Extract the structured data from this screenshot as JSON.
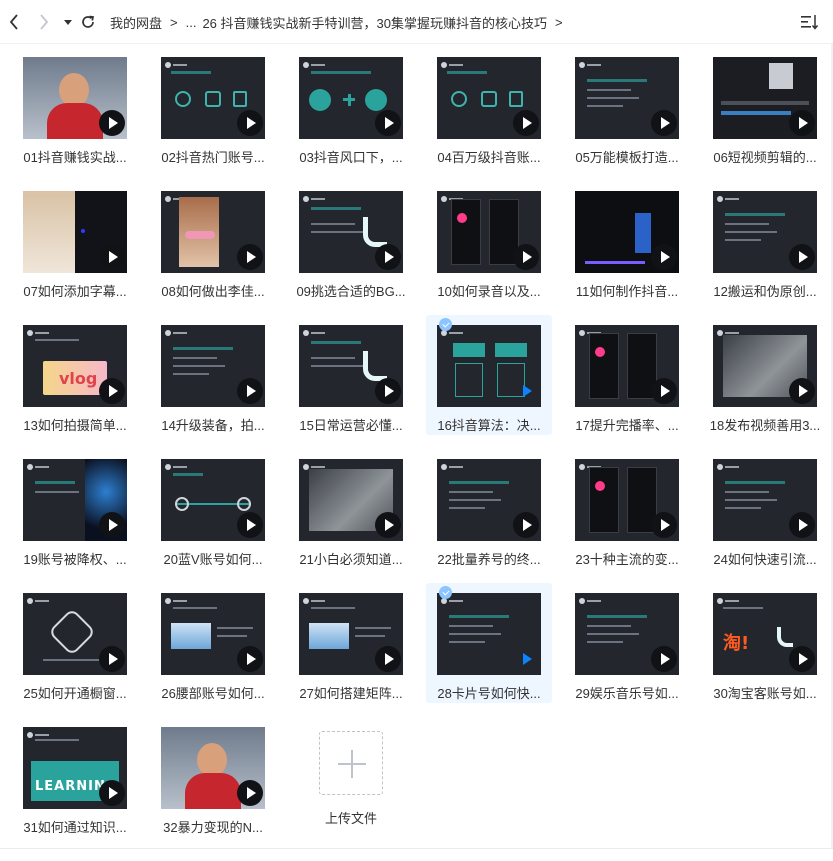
{
  "nav": {
    "back": "back-icon",
    "forward": "forward-icon",
    "history": "chevron-down-icon",
    "refresh": "refresh-icon"
  },
  "breadcrumb": {
    "root": "我的网盘",
    "sep1": ">",
    "ellipsis": "...",
    "current": "26 抖音赚钱实战新手特训营，30集掌握玩赚抖音的核心技巧",
    "sep2": ">",
    "sep3": ">"
  },
  "sort": {
    "icon": "sort-icon"
  },
  "files": [
    {
      "name": "01抖音赚钱实战...",
      "thumb": "person"
    },
    {
      "name": "02抖音热门账号...",
      "thumb": "icons"
    },
    {
      "name": "03抖音风口下，...",
      "thumb": "plus"
    },
    {
      "name": "04百万级抖音账...",
      "thumb": "icons"
    },
    {
      "name": "05万能模板打造...",
      "thumb": "text"
    },
    {
      "name": "06短视频剪辑的...",
      "thumb": "editor"
    },
    {
      "name": "07如何添加字幕...",
      "thumb": "cat"
    },
    {
      "name": "08如何做出李佳...",
      "thumb": "woman"
    },
    {
      "name": "09挑选合适的BG...",
      "thumb": "tiktok"
    },
    {
      "name": "10如何录音以及...",
      "thumb": "phone"
    },
    {
      "name": "11如何制作抖音...",
      "thumb": "desktop"
    },
    {
      "name": "12搬运和伪原创...",
      "thumb": "text"
    },
    {
      "name": "13如何拍摄简单...",
      "thumb": "vlog"
    },
    {
      "name": "14升级装备，拍...",
      "thumb": "text"
    },
    {
      "name": "15日常运营必懂...",
      "thumb": "tiktok"
    },
    {
      "name": "16抖音算法：决...",
      "thumb": "boxes",
      "selected": true
    },
    {
      "name": "17提升完播率、...",
      "thumb": "phone"
    },
    {
      "name": "18发布视频善用3...",
      "thumb": "photo"
    },
    {
      "name": "19账号被降权、...",
      "thumb": "space"
    },
    {
      "name": "20蓝V账号如何...",
      "thumb": "arrows"
    },
    {
      "name": "21小白必须知道...",
      "thumb": "photo"
    },
    {
      "name": "22批量养号的终...",
      "thumb": "text"
    },
    {
      "name": "23十种主流的变...",
      "thumb": "phone"
    },
    {
      "name": "24如何快速引流...",
      "thumb": "text"
    },
    {
      "name": "25如何开通橱窗...",
      "thumb": "hex"
    },
    {
      "name": "26腰部账号如何...",
      "thumb": "sky"
    },
    {
      "name": "27如何搭建矩阵...",
      "thumb": "sky"
    },
    {
      "name": "28卡片号如何快...",
      "thumb": "text",
      "selected": true
    },
    {
      "name": "29娱乐音乐号如...",
      "thumb": "text"
    },
    {
      "name": "30淘宝客账号如...",
      "thumb": "taobao"
    },
    {
      "name": "31如何通过知识...",
      "thumb": "learning"
    },
    {
      "name": "32暴力变现的N...",
      "thumb": "person"
    }
  ],
  "upload": {
    "label": "上传文件",
    "icon": "plus-icon"
  },
  "labels": {
    "vlog": "vlog",
    "taobao": "淘!",
    "learning": "LEARNING"
  },
  "colors": {
    "accent": "#0a84ff",
    "thumb_bg": "#23262d",
    "teal": "#2a8f8c",
    "selected_bg": "#eef6ff"
  }
}
